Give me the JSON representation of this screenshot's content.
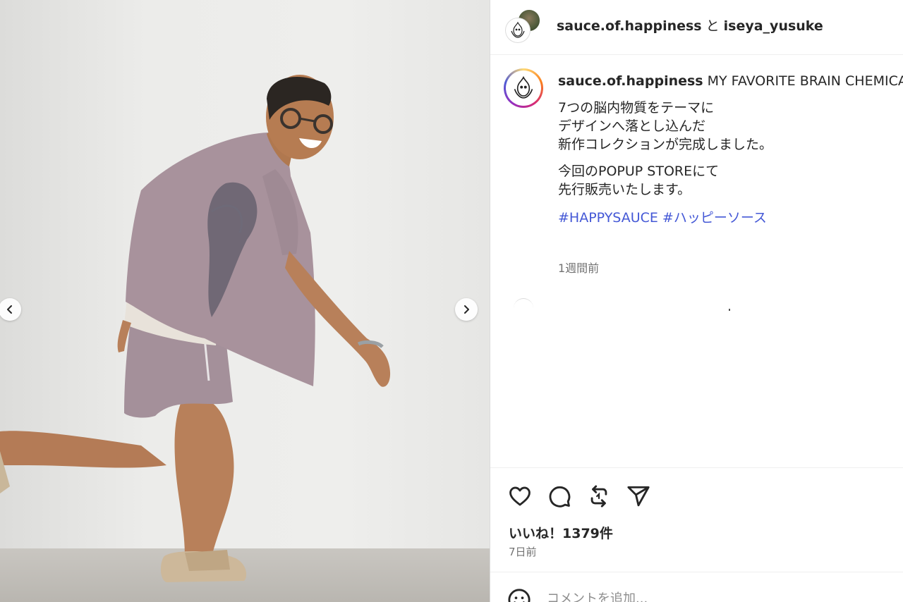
{
  "header": {
    "user1": "sauce.of.happiness",
    "conjunction": "と",
    "user2": "iseya_yusuke"
  },
  "caption": {
    "username": "sauce.of.happiness",
    "first_line": "MY FAVORITE BRAIN CHEMICALS",
    "para1": [
      "7つの脳内物質をテーマに",
      "デザインへ落とし込んだ",
      "新作コレクションが完成しました。"
    ],
    "para2": [
      "今回のPOPUP STOREにて",
      "先行販売いたします。"
    ],
    "hashtags": [
      "#HAPPYSAUCE",
      "#ハッピーソース"
    ],
    "time": "1週間前"
  },
  "actions": {
    "icons": [
      "heart-icon",
      "comment-icon",
      "repost-icon",
      "share-icon"
    ],
    "likes": "いいね！1379件",
    "date": "7日前"
  },
  "comment": {
    "placeholder": "コメントを追加..."
  },
  "media": {
    "icons": [
      "chevron-left-icon",
      "chevron-right-icon"
    ],
    "colors": {
      "wall": "#ececea",
      "floor": "#bdbab4",
      "outfit": "#a8929c",
      "skin": "#b8805a"
    }
  }
}
